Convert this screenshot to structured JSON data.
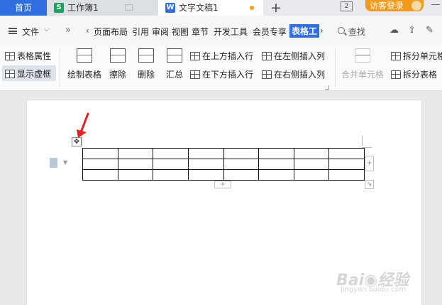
{
  "tabs": {
    "home": "首页",
    "sheet": {
      "label": "工作簿1",
      "badge": "S"
    },
    "doc": {
      "label": "文字文稿1",
      "badge": "W"
    },
    "new_tab": "+"
  },
  "window": {
    "count": "2",
    "login": "访客登录"
  },
  "menu": {
    "file": "文件",
    "more": "»",
    "left_arrow": "‹",
    "right_arrow": "›",
    "items": [
      "页面布局",
      "引用",
      "审阅",
      "视图",
      "章节",
      "开发工具",
      "会员专享",
      "表格工"
    ],
    "search": "查找"
  },
  "ribbon": {
    "table_props": "表格属性",
    "show_grid": "显示虚框",
    "draw_table": "绘制表格",
    "erase": "擦除",
    "delete": "删除",
    "summary": "汇总",
    "insert_above": "在上方插入行",
    "insert_below": "在下方插入行",
    "insert_left": "在左侧插入列",
    "insert_right": "在右侧插入列",
    "merge_cells": "合并单元格",
    "split_cells": "拆分单元格",
    "split_table": "拆分表格"
  },
  "table": {
    "rows": 3,
    "cols": 8
  },
  "controls": {
    "move": "✥",
    "add": "+",
    "resize": "↘"
  },
  "colors": {
    "accent": "#2f6fe0",
    "login": "#f49a1a",
    "arrow": "#e02020",
    "sheet_green": "#1aa15f"
  },
  "watermark": {
    "brand": "Bai◉经验",
    "url": "jingyan.baidu.com"
  }
}
